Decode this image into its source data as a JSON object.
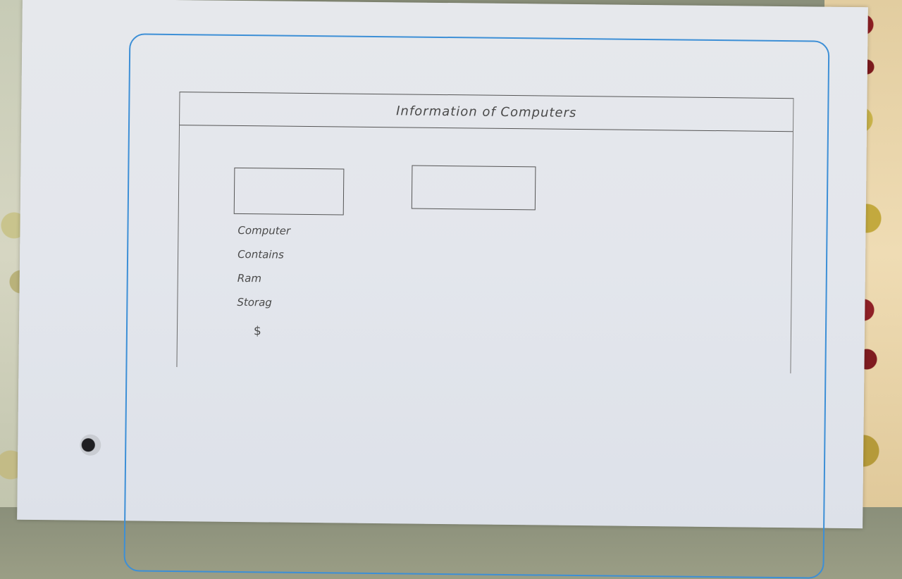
{
  "window": {
    "title": "Information of Computers"
  },
  "product": {
    "fields": [
      "Computer",
      "Contains",
      "Ram",
      "Storag"
    ],
    "price_symbol": "$"
  }
}
